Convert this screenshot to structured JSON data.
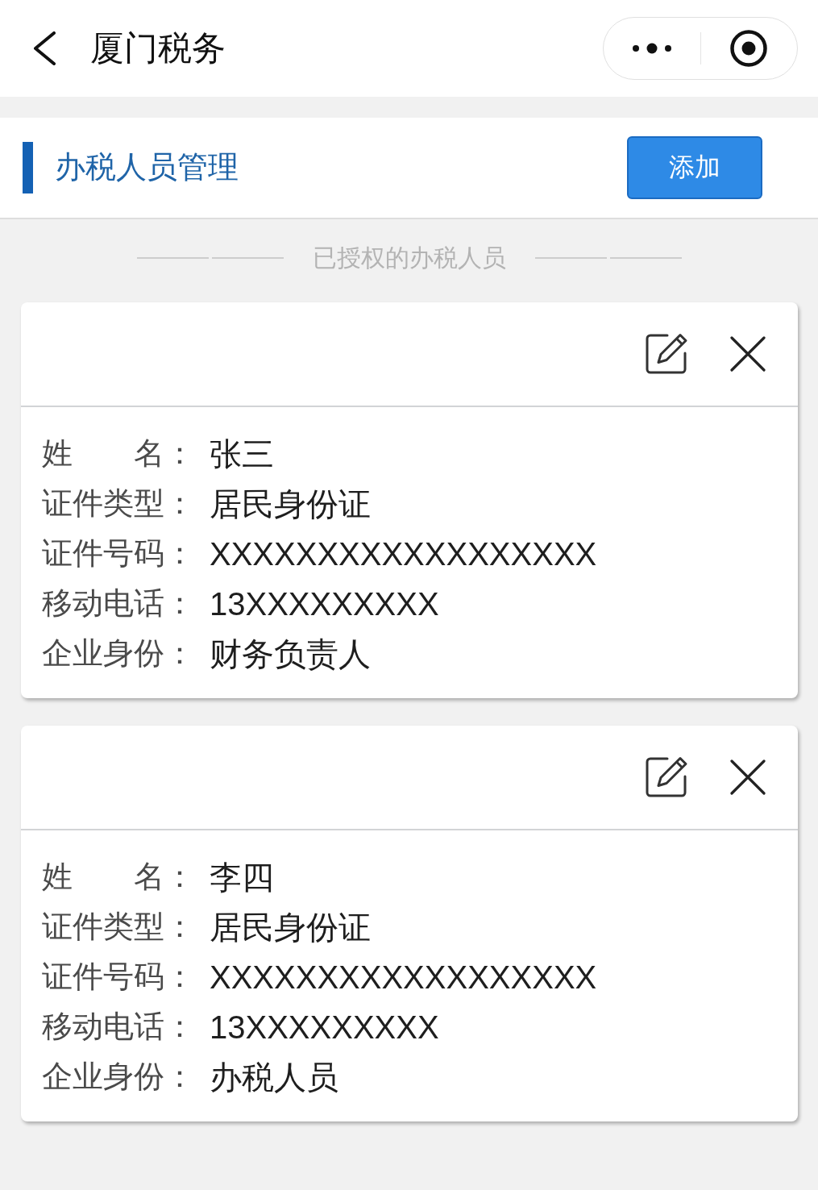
{
  "nav_bar": {
    "title": "厦门税务"
  },
  "header": {
    "title": "办税人员管理",
    "add_button": "添加"
  },
  "divider_label": "已授权的办税人员",
  "people": [
    {
      "fields": [
        {
          "label": "姓　　名：",
          "value": "张三"
        },
        {
          "label": "证件类型：",
          "value": "居民身份证"
        },
        {
          "label": "证件号码：",
          "value": "XXXXXXXXXXXXXXXXXX"
        },
        {
          "label": "移动电话：",
          "value": "13XXXXXXXXX"
        },
        {
          "label": "企业身份：",
          "value": "财务负责人"
        }
      ]
    },
    {
      "fields": [
        {
          "label": "姓　　名：",
          "value": "李四"
        },
        {
          "label": "证件类型：",
          "value": "居民身份证"
        },
        {
          "label": "证件号码：",
          "value": "XXXXXXXXXXXXXXXXXX"
        },
        {
          "label": "移动电话：",
          "value": "13XXXXXXXXX"
        },
        {
          "label": "企业身份：",
          "value": "办税人员"
        }
      ]
    }
  ]
}
